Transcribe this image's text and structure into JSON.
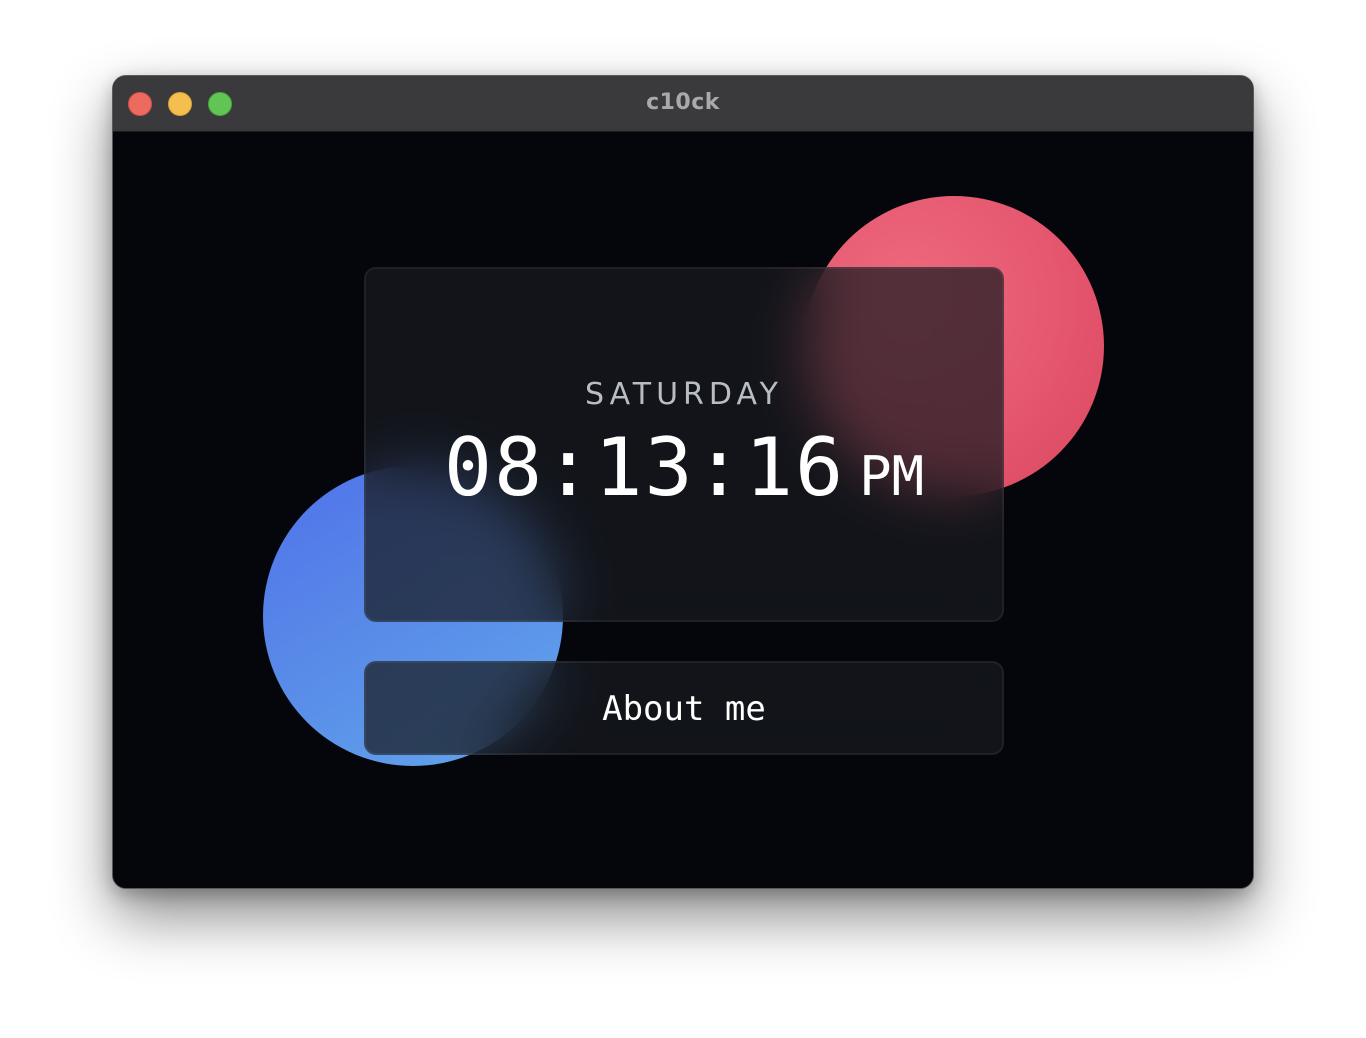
{
  "window": {
    "title": "c10ck"
  },
  "clock": {
    "day": "SATURDAY",
    "time": "08:13:16",
    "meridiem": "PM"
  },
  "actions": {
    "about_label": "About me"
  },
  "colors": {
    "accent_red": "#e5576f",
    "accent_blue": "#5889e8",
    "background": "#04060b",
    "titlebar": "#3a3a3c"
  }
}
